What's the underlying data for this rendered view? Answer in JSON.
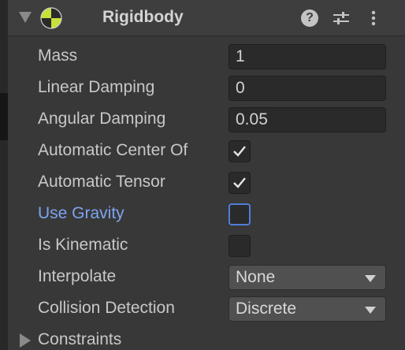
{
  "header": {
    "title": "Rigidbody",
    "help_glyph": "?"
  },
  "fields": {
    "mass": {
      "label": "Mass",
      "value": "1"
    },
    "linear_damping": {
      "label": "Linear Damping",
      "value": "0"
    },
    "angular_damping": {
      "label": "Angular Damping",
      "value": "0.05"
    },
    "automatic_center_of_mass": {
      "label": "Automatic Center Of",
      "checked": true
    },
    "automatic_tensor": {
      "label": "Automatic Tensor",
      "checked": true
    },
    "use_gravity": {
      "label": "Use Gravity",
      "checked": false
    },
    "is_kinematic": {
      "label": "Is Kinematic",
      "checked": false
    },
    "interpolate": {
      "label": "Interpolate",
      "selected": "None"
    },
    "collision_detection": {
      "label": "Collision Detection",
      "selected": "Discrete"
    }
  },
  "constraints": {
    "label": "Constraints"
  },
  "icons": {
    "foldout": "triangle-down-icon",
    "component": "rigidbody-icon",
    "help": "help-icon",
    "presets": "presets-icon",
    "menu": "kebab-menu-icon"
  },
  "colors": {
    "panel_bg": "#383838",
    "header_bg": "#3e3e3e",
    "field_bg": "#2a2a2a",
    "dropdown_bg": "#505050",
    "label_text": "#c8c8c8",
    "highlight_label": "#7ba4f0",
    "focus_border": "#4f7ed8",
    "rigidbody_icon_yellow": "#c8e03a"
  }
}
